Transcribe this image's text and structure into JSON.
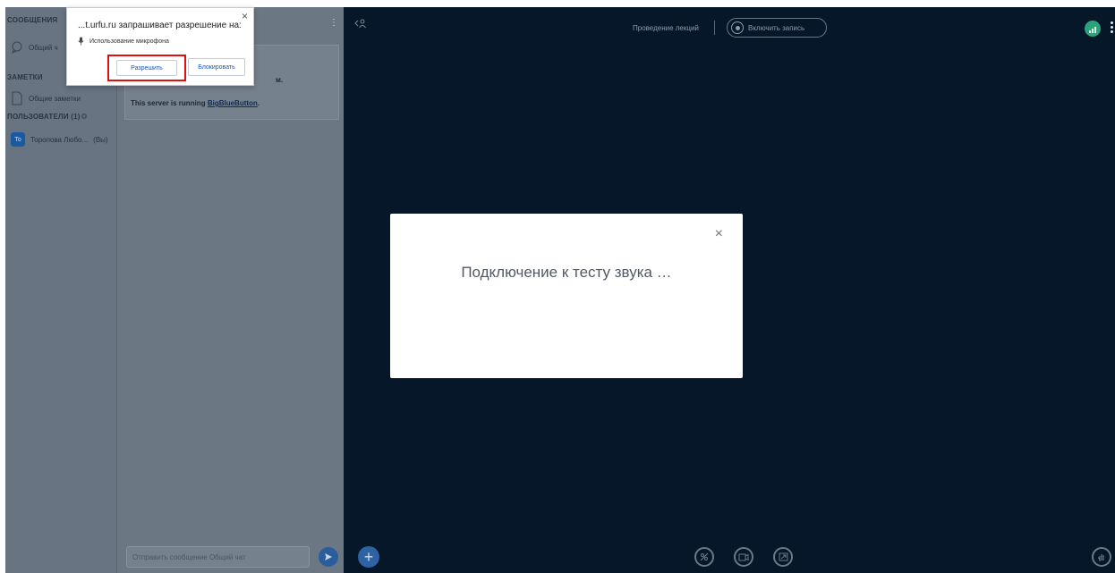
{
  "userlist": {
    "messages_title": "СООБЩЕНИЯ",
    "public_chat": "Общий ч",
    "notes_title": "ЗАМЕТКИ",
    "shared_notes": "Общие заметки",
    "users_title": "ПОЛЬЗОВАТЕЛИ (1)",
    "user_name": "Торопова Любо...",
    "user_you": "(Вы)",
    "avatar_initials": "То"
  },
  "chat": {
    "welcome_line1": "м.",
    "welcome_line2_prefix": "This server is running ",
    "welcome_line2_link": "BigBlueButton",
    "welcome_line2_suffix": ".",
    "input_placeholder": "Отправить сообщение Общий чат"
  },
  "header": {
    "meeting_title": "Проведение лекций",
    "record_label": "Включить запись"
  },
  "modal": {
    "message": "Подключение к тесту звука …",
    "close_glyph": "×"
  },
  "permission_popup": {
    "title": "...t.urfu.ru запрашивает разрешение на:",
    "subtitle": "Использование микрофона",
    "allow_label": "Разрешить",
    "block_label": "Блокировать",
    "close_glyph": "×"
  },
  "colors": {
    "media_bg": "#06172a",
    "highlight_red": "#e01010",
    "connection_green": "#2aa27a"
  }
}
